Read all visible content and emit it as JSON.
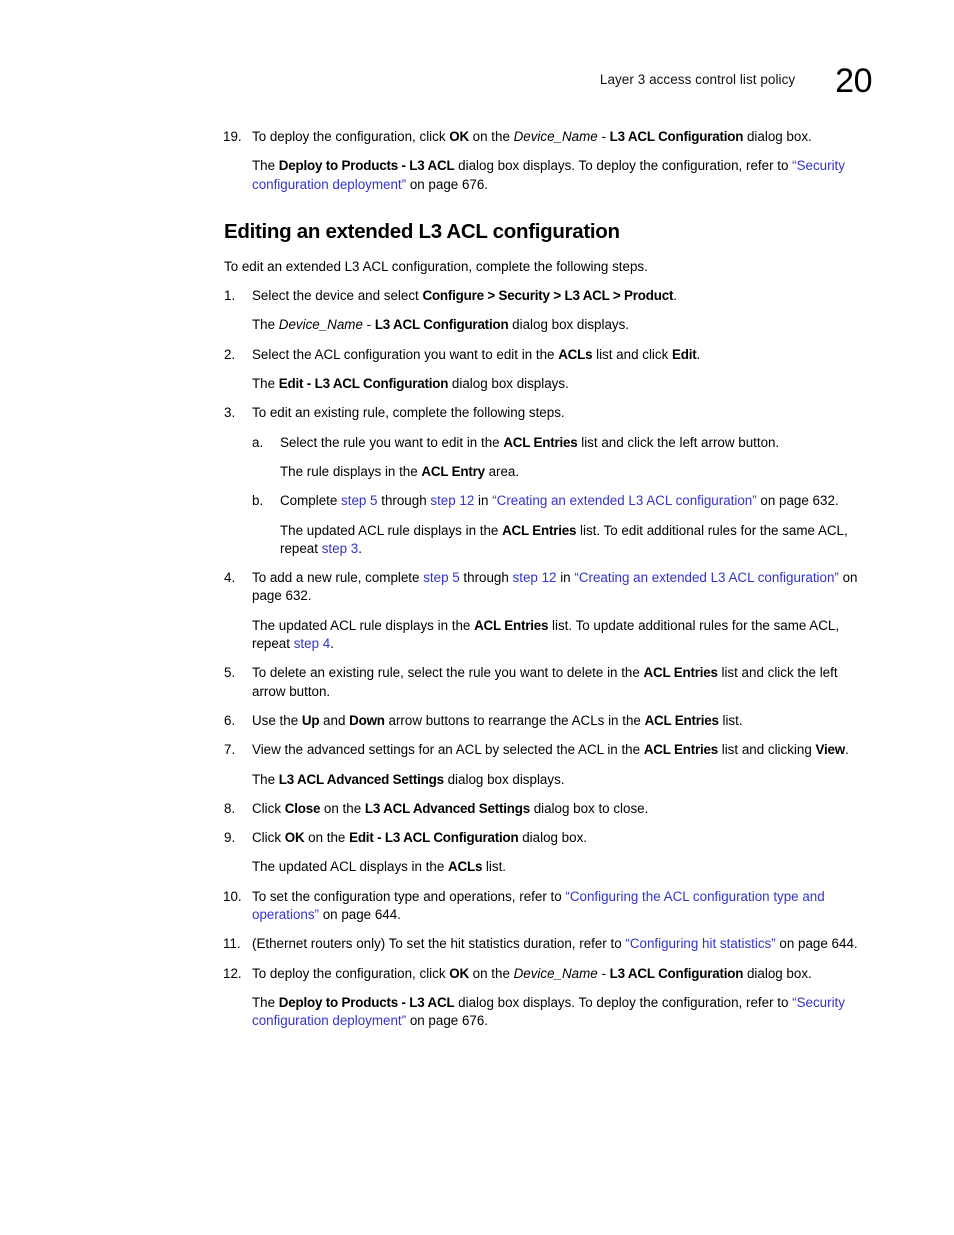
{
  "header": {
    "title": "Layer 3 access control list policy",
    "chapter_number": "20"
  },
  "colors": {
    "link": "#3333CC",
    "text": "#000000",
    "background": "#FFFFFF"
  },
  "section": {
    "heading": "Editing an extended L3 ACL configuration"
  },
  "blocks": [
    {
      "name": "step-19",
      "kind": "li",
      "marker": "19.",
      "wide": true,
      "segments": [
        {
          "text": "To deploy the configuration, click "
        },
        {
          "text": "OK",
          "style": "bold"
        },
        {
          "text": " on the "
        },
        {
          "text": "Device_Name",
          "style": "italic"
        },
        {
          "text": " - "
        },
        {
          "text": "L3 ACL Configuration",
          "style": "bold"
        },
        {
          "text": " dialog box."
        }
      ]
    },
    {
      "name": "step-19-result",
      "kind": "cont",
      "segments": [
        {
          "text": "The "
        },
        {
          "text": "Deploy to Products - L3 ACL",
          "style": "bold"
        },
        {
          "text": " dialog box displays. To deploy the configuration, refer to "
        },
        {
          "text": "“Security configuration deployment”",
          "style": "link"
        },
        {
          "text": " on page 676."
        }
      ]
    },
    {
      "name": "section-heading",
      "kind": "heading",
      "segments": [
        {
          "text": "Editing an extended L3 ACL configuration"
        }
      ]
    },
    {
      "name": "section-intro",
      "kind": "para",
      "segments": [
        {
          "text": "To edit an extended L3 ACL configuration, complete the following steps."
        }
      ]
    },
    {
      "name": "step-1",
      "kind": "li",
      "marker": "1.",
      "segments": [
        {
          "text": "Select the device and select "
        },
        {
          "text": "Configure > Security > L3 ACL > Product",
          "style": "bold"
        },
        {
          "text": "."
        }
      ]
    },
    {
      "name": "step-1-result",
      "kind": "cont",
      "segments": [
        {
          "text": "The "
        },
        {
          "text": "Device_Name",
          "style": "italic"
        },
        {
          "text": " - "
        },
        {
          "text": "L3 ACL Configuration",
          "style": "bold"
        },
        {
          "text": " dialog box displays."
        }
      ]
    },
    {
      "name": "step-2",
      "kind": "li",
      "marker": "2.",
      "segments": [
        {
          "text": "Select the ACL configuration you want to edit in the "
        },
        {
          "text": "ACLs",
          "style": "bold"
        },
        {
          "text": " list and click "
        },
        {
          "text": "Edit",
          "style": "bold"
        },
        {
          "text": "."
        }
      ]
    },
    {
      "name": "step-2-result",
      "kind": "cont",
      "segments": [
        {
          "text": "The "
        },
        {
          "text": "Edit - L3 ACL Configuration",
          "style": "bold"
        },
        {
          "text": " dialog box displays."
        }
      ]
    },
    {
      "name": "step-3",
      "kind": "li",
      "marker": "3.",
      "segments": [
        {
          "text": "To edit an existing rule, complete the following steps."
        }
      ]
    },
    {
      "name": "step-3a",
      "kind": "li-sub",
      "marker": "a.",
      "segments": [
        {
          "text": "Select the rule you want to edit in the "
        },
        {
          "text": "ACL Entries",
          "style": "bold"
        },
        {
          "text": " list and click the left arrow button."
        }
      ]
    },
    {
      "name": "step-3a-result",
      "kind": "cont-sub",
      "segments": [
        {
          "text": "The rule displays in the "
        },
        {
          "text": "ACL Entry",
          "style": "bold"
        },
        {
          "text": " area."
        }
      ]
    },
    {
      "name": "step-3b",
      "kind": "li-sub",
      "marker": "b.",
      "segments": [
        {
          "text": "Complete "
        },
        {
          "text": "step 5",
          "style": "link"
        },
        {
          "text": " through "
        },
        {
          "text": "step 12",
          "style": "link"
        },
        {
          "text": " in "
        },
        {
          "text": "“Creating an extended L3 ACL configuration”",
          "style": "link"
        },
        {
          "text": " on page 632."
        }
      ]
    },
    {
      "name": "step-3b-result",
      "kind": "cont-sub",
      "segments": [
        {
          "text": "The updated ACL rule displays in the "
        },
        {
          "text": "ACL Entries",
          "style": "bold"
        },
        {
          "text": " list. To edit additional rules for the same ACL, repeat "
        },
        {
          "text": "step 3",
          "style": "link"
        },
        {
          "text": "."
        }
      ]
    },
    {
      "name": "step-4",
      "kind": "li",
      "marker": "4.",
      "segments": [
        {
          "text": "To add a new rule, complete "
        },
        {
          "text": "step 5",
          "style": "link"
        },
        {
          "text": " through "
        },
        {
          "text": "step 12",
          "style": "link"
        },
        {
          "text": " in "
        },
        {
          "text": "“Creating an extended L3 ACL configuration”",
          "style": "link"
        },
        {
          "text": " on page 632."
        }
      ]
    },
    {
      "name": "step-4-result",
      "kind": "cont",
      "segments": [
        {
          "text": "The updated ACL rule displays in the "
        },
        {
          "text": "ACL Entries",
          "style": "bold"
        },
        {
          "text": " list. To update additional rules for the same ACL, repeat "
        },
        {
          "text": "step 4",
          "style": "link"
        },
        {
          "text": "."
        }
      ]
    },
    {
      "name": "step-5",
      "kind": "li",
      "marker": "5.",
      "segments": [
        {
          "text": "To delete an existing rule, select the rule you want to delete in the "
        },
        {
          "text": "ACL Entries",
          "style": "bold"
        },
        {
          "text": " list and click the left arrow button."
        }
      ]
    },
    {
      "name": "step-6",
      "kind": "li",
      "marker": "6.",
      "segments": [
        {
          "text": "Use the "
        },
        {
          "text": "Up",
          "style": "bold"
        },
        {
          "text": " and "
        },
        {
          "text": "Down",
          "style": "bold"
        },
        {
          "text": " arrow buttons to rearrange the ACLs in the "
        },
        {
          "text": "ACL Entries",
          "style": "bold"
        },
        {
          "text": " list."
        }
      ]
    },
    {
      "name": "step-7",
      "kind": "li",
      "marker": "7.",
      "segments": [
        {
          "text": "View the advanced settings for an ACL by selected the ACL in the "
        },
        {
          "text": "ACL Entries",
          "style": "bold"
        },
        {
          "text": " list and clicking "
        },
        {
          "text": "View",
          "style": "bold"
        },
        {
          "text": "."
        }
      ]
    },
    {
      "name": "step-7-result",
      "kind": "cont",
      "segments": [
        {
          "text": "The "
        },
        {
          "text": "L3 ACL Advanced Settings",
          "style": "bold"
        },
        {
          "text": " dialog box displays."
        }
      ]
    },
    {
      "name": "step-8",
      "kind": "li",
      "marker": "8.",
      "segments": [
        {
          "text": "Click "
        },
        {
          "text": "Close",
          "style": "bold"
        },
        {
          "text": " on the "
        },
        {
          "text": "L3 ACL Advanced Settings",
          "style": "bold"
        },
        {
          "text": " dialog box to close."
        }
      ]
    },
    {
      "name": "step-9",
      "kind": "li",
      "marker": "9.",
      "segments": [
        {
          "text": "Click "
        },
        {
          "text": "OK",
          "style": "bold"
        },
        {
          "text": " on the "
        },
        {
          "text": "Edit - L3 ACL Configuration",
          "style": "bold"
        },
        {
          "text": " dialog box."
        }
      ]
    },
    {
      "name": "step-9-result",
      "kind": "cont",
      "segments": [
        {
          "text": "The updated ACL displays in the "
        },
        {
          "text": "ACLs",
          "style": "bold"
        },
        {
          "text": " list."
        }
      ]
    },
    {
      "name": "step-10",
      "kind": "li",
      "marker": "10.",
      "wide": true,
      "segments": [
        {
          "text": "To set the configuration type and operations, refer to "
        },
        {
          "text": "“Configuring the ACL configuration type and operations”",
          "style": "link"
        },
        {
          "text": " on page 644."
        }
      ]
    },
    {
      "name": "step-11",
      "kind": "li",
      "marker": "11.",
      "wide": true,
      "segments": [
        {
          "text": "(Ethernet routers only) To set the hit statistics duration, refer to "
        },
        {
          "text": "“Configuring hit statistics”",
          "style": "link"
        },
        {
          "text": " on page 644."
        }
      ]
    },
    {
      "name": "step-12",
      "kind": "li",
      "marker": "12.",
      "wide": true,
      "segments": [
        {
          "text": "To deploy the configuration, click "
        },
        {
          "text": "OK",
          "style": "bold"
        },
        {
          "text": " on the "
        },
        {
          "text": "Device_Name",
          "style": "italic"
        },
        {
          "text": " - "
        },
        {
          "text": "L3 ACL Configuration",
          "style": "bold"
        },
        {
          "text": " dialog box."
        }
      ]
    },
    {
      "name": "step-12-result",
      "kind": "cont",
      "segments": [
        {
          "text": "The "
        },
        {
          "text": "Deploy to Products - L3 ACL",
          "style": "bold"
        },
        {
          "text": " dialog box displays. To deploy the configuration, refer to "
        },
        {
          "text": "“Security configuration deployment”",
          "style": "link"
        },
        {
          "text": " on page 676."
        }
      ]
    }
  ],
  "spacing": {
    "gap_between_steps": 11,
    "gap_before_heading": 26,
    "gap_after_heading": 14
  }
}
